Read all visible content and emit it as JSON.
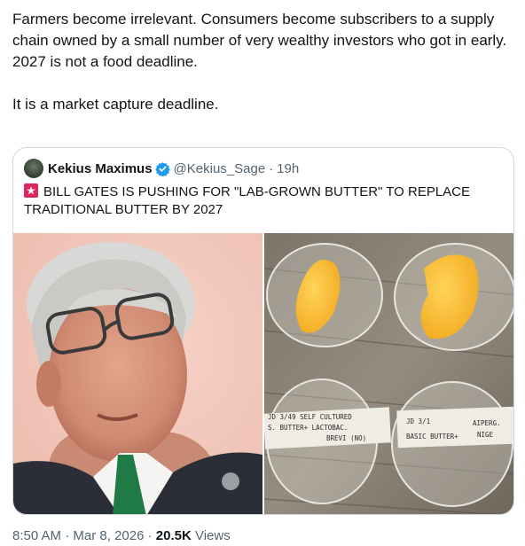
{
  "tweet": {
    "lines": [
      "Farmers become irrelevant. Consumers become subscribers to a supply chain owned by a small number of very wealthy investors who got in early.",
      "2027 is not a food deadline.",
      "It is a market capture deadline."
    ]
  },
  "quote": {
    "author_name": "Kekius Maximus",
    "handle": "@Kekius_Sage",
    "separator": "·",
    "time": "19h",
    "text": "BILL GATES IS PUSHING FOR \"LAB-GROWN BUTTER\" TO REPLACE TRADITIONAL BUTTER BY 2027",
    "dish_labels": {
      "left_line1": "JD 3/49 SELF CULTURED",
      "left_line2": "S. BUTTER+ LACTOBAC.",
      "left_line3": "BREVI (NO)",
      "right_line1": "JD 3/1",
      "right_line2": "BASIC BUTTER+",
      "right_line3": "AIPERG.",
      "right_line4": "NIGE"
    }
  },
  "meta": {
    "time": "8:50 AM",
    "sep1": "·",
    "date": "Mar 8, 2026",
    "sep2": "·",
    "views_count": "20.5K",
    "views_label": "Views"
  },
  "colors": {
    "text": "#0f1419",
    "secondary": "#536471",
    "verified": "#1d9bf0",
    "border": "#cfd9de"
  }
}
